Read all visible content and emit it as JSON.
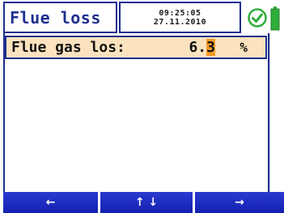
{
  "header": {
    "title": "Flue loss",
    "time": "09:25:05",
    "date": "27.11.2010",
    "status_icon": "check-circle-icon",
    "battery_icon": "battery-icon"
  },
  "reading": {
    "label": "Flue gas los:",
    "value_prefix": "6.",
    "value_cursor_digit": "3",
    "unit": "%"
  },
  "softkeys": [
    {
      "label": "←",
      "icon": "arrow-left-icon"
    },
    {
      "label": "↑ ↓",
      "icon": "arrow-up-down-icon"
    },
    {
      "label": "→",
      "icon": "arrow-right-icon"
    }
  ],
  "colors": {
    "frame": "#1d2f8f",
    "highlight_row": "#fbe3bf",
    "cursor": "#f49a2a",
    "softkey": "#1a2ac0",
    "status_ok": "#2fae3a"
  }
}
